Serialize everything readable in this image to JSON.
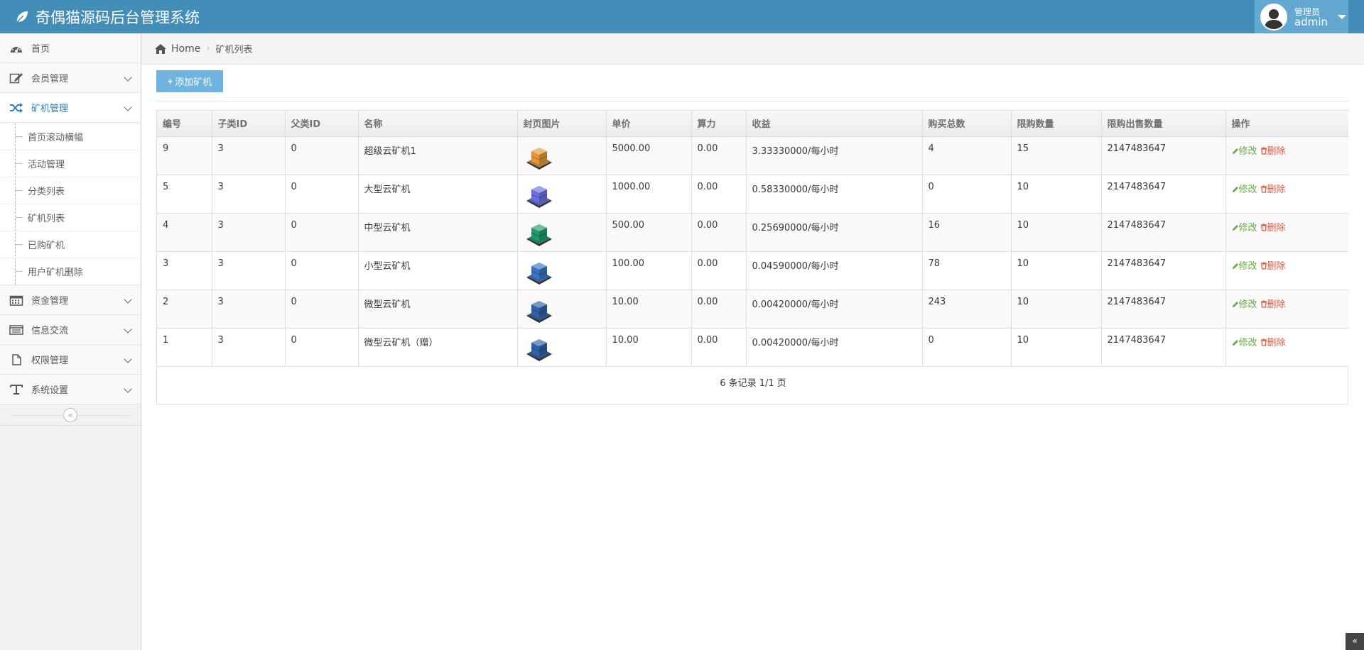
{
  "app": {
    "title": "奇偶猫源码后台管理系统"
  },
  "user": {
    "role": "管理员",
    "name": "admin"
  },
  "sidebar": {
    "items": [
      {
        "label": "首页",
        "icon": "dashboard-icon"
      },
      {
        "label": "会员管理",
        "icon": "edit-icon"
      },
      {
        "label": "矿机管理",
        "icon": "shuffle-icon"
      },
      {
        "label": "资金管理",
        "icon": "calendar-icon"
      },
      {
        "label": "信息交流",
        "icon": "list-icon"
      },
      {
        "label": "权限管理",
        "icon": "file-icon"
      },
      {
        "label": "系统设置",
        "icon": "text-icon"
      }
    ],
    "sub_items": [
      "首页滚动横幅",
      "活动管理",
      "分类列表",
      "矿机列表",
      "已购矿机",
      "用户矿机删除"
    ]
  },
  "breadcrumb": {
    "home": "Home",
    "current": "矿机列表"
  },
  "toolbar": {
    "add_label": "添加矿机"
  },
  "table": {
    "headers": [
      "编号",
      "子类ID",
      "父类ID",
      "名称",
      "封页图片",
      "单价",
      "算力",
      "收益",
      "购买总数",
      "限购数量",
      "限购出售数量",
      "操作"
    ],
    "rows": [
      {
        "id": "9",
        "sub_id": "3",
        "parent_id": "0",
        "name": "超级云矿机1",
        "image": "orange",
        "price": "5000.00",
        "power": "0.00",
        "income": "3.33330000/每小时",
        "total": "4",
        "limit": "15",
        "limit_sell": "2147483647"
      },
      {
        "id": "5",
        "sub_id": "3",
        "parent_id": "0",
        "name": "大型云矿机",
        "image": "purple",
        "price": "1000.00",
        "power": "0.00",
        "income": "0.58330000/每小时",
        "total": "0",
        "limit": "10",
        "limit_sell": "2147483647"
      },
      {
        "id": "4",
        "sub_id": "3",
        "parent_id": "0",
        "name": "中型云矿机",
        "image": "green",
        "price": "500.00",
        "power": "0.00",
        "income": "0.25690000/每小时",
        "total": "16",
        "limit": "10",
        "limit_sell": "2147483647"
      },
      {
        "id": "3",
        "sub_id": "3",
        "parent_id": "0",
        "name": "小型云矿机",
        "image": "blue",
        "price": "100.00",
        "power": "0.00",
        "income": "0.04590000/每小时",
        "total": "78",
        "limit": "10",
        "limit_sell": "2147483647"
      },
      {
        "id": "2",
        "sub_id": "3",
        "parent_id": "0",
        "name": "微型云矿机",
        "image": "darkblue",
        "price": "10.00",
        "power": "0.00",
        "income": "0.00420000/每小时",
        "total": "243",
        "limit": "10",
        "limit_sell": "2147483647"
      },
      {
        "id": "1",
        "sub_id": "3",
        "parent_id": "0",
        "name": "微型云矿机（赠）",
        "image": "darkblue",
        "price": "10.00",
        "power": "0.00",
        "income": "0.00420000/每小时",
        "total": "0",
        "limit": "10",
        "limit_sell": "2147483647"
      }
    ],
    "edit_label": "修改",
    "delete_label": "删除"
  },
  "pager": {
    "text": "6 条记录 1/1 页"
  },
  "colors": {
    "navbar": "#438eb9",
    "user_box": "#62a8d1",
    "button": "#6fb3e0",
    "edit": "#69aa46",
    "delete": "#dd5a43",
    "active_nav": "#2b7dbc",
    "cube_orange": "#e3953a",
    "cube_purple": "#6a6fe0",
    "cube_green": "#1f9a6a",
    "cube_blue": "#3a74c2",
    "cube_darkblue": "#2f62a8"
  }
}
